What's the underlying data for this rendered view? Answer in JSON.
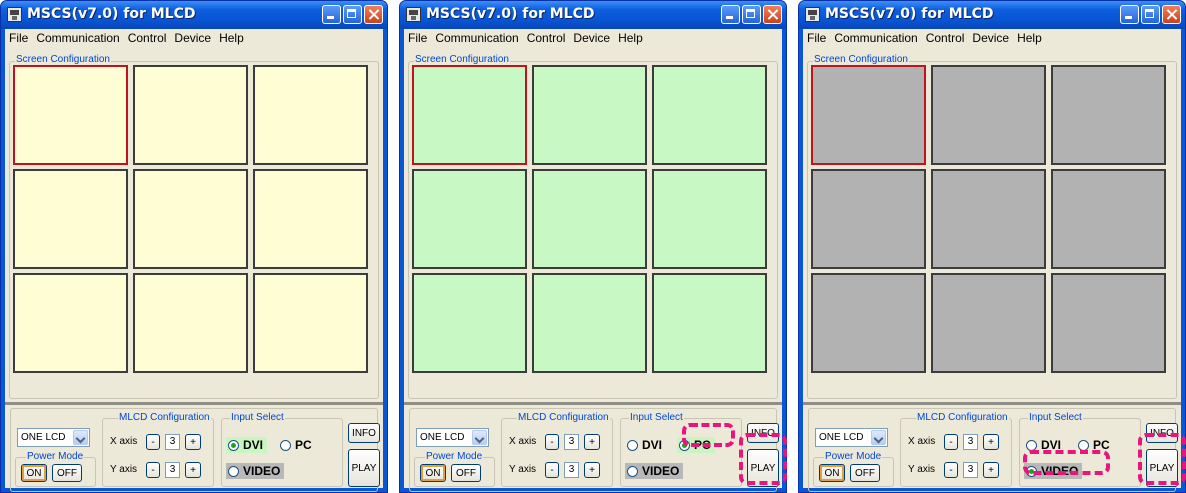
{
  "windows": [
    {
      "title": "MSCS(v7.0) for MLCD",
      "menu": [
        "File",
        "Communication",
        "Control",
        "Device",
        "Help"
      ],
      "screen_group_label": "Screen Configuration",
      "cell_color": "#fffdd4",
      "selected_cell": 0,
      "lcd_select": "ONE LCD",
      "power_mode_label": "Power Mode",
      "power_on": "ON",
      "power_off": "OFF",
      "mlcd_config_label": "MLCD Configuration",
      "x_axis_label": "X axis",
      "x_axis_value": "3",
      "y_axis_label": "Y axis",
      "y_axis_value": "3",
      "minus": "-",
      "plus": "+",
      "input_select_label": "Input Select",
      "dvi": "DVI",
      "pc": "PC",
      "video": "VIDEO",
      "selected_input": "DVI",
      "info": "INFO",
      "play": "PLAY"
    },
    {
      "title": "MSCS(v7.0) for MLCD",
      "menu": [
        "File",
        "Communication",
        "Control",
        "Device",
        "Help"
      ],
      "screen_group_label": "Screen Configuration",
      "cell_color": "#c8f8c4",
      "selected_cell": 0,
      "lcd_select": "ONE LCD",
      "power_mode_label": "Power Mode",
      "power_on": "ON",
      "power_off": "OFF",
      "mlcd_config_label": "MLCD Configuration",
      "x_axis_label": "X axis",
      "x_axis_value": "3",
      "y_axis_label": "Y axis",
      "y_axis_value": "3",
      "minus": "-",
      "plus": "+",
      "input_select_label": "Input Select",
      "dvi": "DVI",
      "pc": "PC",
      "video": "VIDEO",
      "selected_input": "PC",
      "info": "INFO",
      "play": "PLAY"
    },
    {
      "title": "MSCS(v7.0) for MLCD",
      "menu": [
        "File",
        "Communication",
        "Control",
        "Device",
        "Help"
      ],
      "screen_group_label": "Screen Configuration",
      "cell_color": "#b2b2b2",
      "selected_cell": 0,
      "lcd_select": "ONE LCD",
      "power_mode_label": "Power Mode",
      "power_on": "ON",
      "power_off": "OFF",
      "mlcd_config_label": "MLCD Configuration",
      "x_axis_label": "X axis",
      "x_axis_value": "3",
      "y_axis_label": "Y axis",
      "y_axis_value": "3",
      "minus": "-",
      "plus": "+",
      "input_select_label": "Input Select",
      "dvi": "DVI",
      "pc": "PC",
      "video": "VIDEO",
      "selected_input": "VIDEO",
      "info": "INFO",
      "play": "PLAY"
    }
  ],
  "colors": {
    "highlight_dash": "#e8157d",
    "selected_cell_border": "#c0141c"
  }
}
